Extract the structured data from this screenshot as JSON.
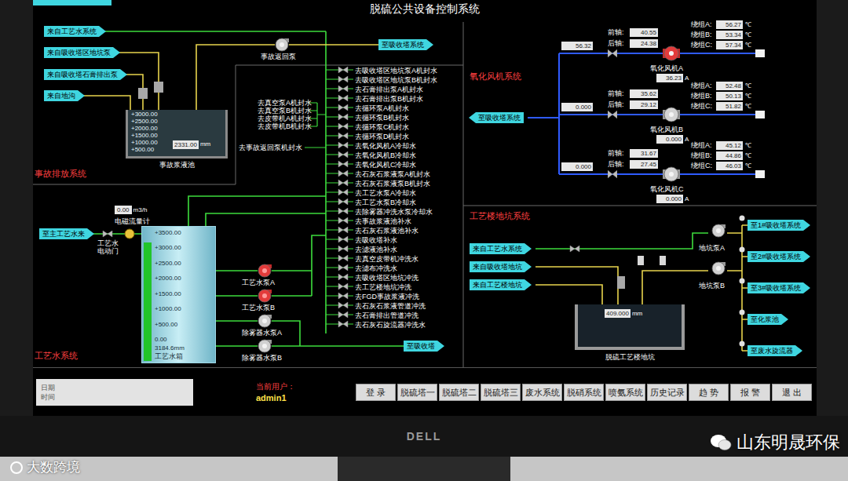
{
  "title": "脱硫公共设备控制系统",
  "accident": {
    "label": "事故排放系统",
    "sources": [
      "来自工艺水系统",
      "来自吸收塔区地坑泵",
      "来自吸收塔石膏排出泵",
      "来自地沟"
    ],
    "pump": {
      "name": "事故返回泵",
      "running": false
    },
    "destination": "至吸收塔系统",
    "tank": {
      "name": "事故浆液池",
      "scale": [
        "+3000.00",
        "+2500.00",
        "+2000.00",
        "+1500.00",
        "+1000.00",
        "+500.00"
      ],
      "reading": "2331.00",
      "unit": "mm"
    }
  },
  "consumers": {
    "main": [
      "去吸收塔区地坑泵A机封水",
      "去吸收塔区地坑泵B机封水",
      "去石膏排出泵A机封水",
      "去石膏排出泵B机封水",
      "去循环泵A机封水",
      "去循环泵B机封水",
      "去循环泵C机封水",
      "去循环泵D机封水",
      "去氧化风机A冷却水",
      "去氧化风机B冷却水",
      "去氧化风机C冷却水",
      "去石灰石浆液泵A机封水",
      "去石灰石浆液泵B机封水",
      "去工艺水泵A冷却水",
      "去工艺水泵B冷却水",
      "去除雾器冲洗水泵冷却水",
      "去事故浆液池补水",
      "去石灰石浆液池补水",
      "去吸收塔补水",
      "去滤液池补水",
      "去真空皮带机冲洗水",
      "去滤布冲洗水",
      "去吸收塔区地坑冲洗",
      "去工艺楼地坑冲洗",
      "去FGD事故浆液冲洗",
      "去石灰石浆液管道冲洗",
      "去石膏排出管道冲洗",
      "去石灰石旋流器冲洗水"
    ],
    "side": [
      "去真空泵A机封水",
      "去真空泵B机封水",
      "去皮带机A机封水",
      "去皮带机B机封水"
    ],
    "extra": "去事故返回泵机封水"
  },
  "process_water": {
    "label": "工艺水系统",
    "source": "至主工艺水来",
    "valve": "工艺水电动门",
    "flowmeter": "电磁流量计",
    "flow_reading": "0.00",
    "flow_unit": "m3/h",
    "tank": {
      "name": "工艺水箱",
      "scale": [
        "+3500.00",
        "+3000.00",
        "+2500.00",
        "+2000.00",
        "+1500.00",
        "+1000.00",
        "+500.00",
        "0.00"
      ],
      "reading": "3184.6mm",
      "level": 0.91
    },
    "pumps": [
      {
        "name": "工艺水泵A",
        "running": true
      },
      {
        "name": "工艺水泵B",
        "running": true
      },
      {
        "name": "除雾器水泵A",
        "running": false
      },
      {
        "name": "除雾器水泵B",
        "running": false
      }
    ],
    "destination": "至吸收塔"
  },
  "oxidation": {
    "label": "氧化风机系统",
    "destination": "至吸收塔系统",
    "temp_unit": "℃",
    "current_unit": "A",
    "fans": [
      {
        "name": "氧化风机A",
        "running": true,
        "pressure": "56.32",
        "front_label": "前轴:",
        "front": "40.55",
        "rear_label": "后轴:",
        "rear": "24.38",
        "windings": [
          {
            "label": "绕组A:",
            "value": "56.27"
          },
          {
            "label": "绕组B:",
            "value": "53.34"
          },
          {
            "label": "绕组C:",
            "value": "57.34"
          }
        ],
        "current": "36.23"
      },
      {
        "name": "氧化风机B",
        "running": false,
        "pressure": "0.000",
        "front_label": "前轴:",
        "front": "35.62",
        "rear_label": "后轴:",
        "rear": "29.12",
        "windings": [
          {
            "label": "绕组A:",
            "value": "52.48"
          },
          {
            "label": "绕组B:",
            "value": "50.13"
          },
          {
            "label": "绕组C:",
            "value": "51.82"
          }
        ],
        "current": "0.000"
      },
      {
        "name": "氧化风机C",
        "running": false,
        "pressure": "0.000",
        "front_label": "前轴:",
        "front": "31.67",
        "rear_label": "后轴:",
        "rear": "27.45",
        "windings": [
          {
            "label": "绕组A:",
            "value": "45.12"
          },
          {
            "label": "绕组B:",
            "value": "44.86"
          },
          {
            "label": "绕组C:",
            "value": "46.03"
          }
        ],
        "current": "0.000"
      }
    ]
  },
  "pit": {
    "label": "工艺楼地坑系统",
    "sources": [
      "来自工艺水系统",
      "来自吸收塔地坑",
      "来自工艺楼地坑"
    ],
    "pumps": [
      {
        "name": "地坑泵A",
        "running": false
      },
      {
        "name": "地坑泵B",
        "running": false
      }
    ],
    "pit_name": "脱硫工艺楼地坑",
    "reading": "409.000",
    "unit": "mm",
    "destinations": [
      "至1#吸收塔系统",
      "至2#吸收塔系统",
      "至3#吸收塔系统",
      "至化浆池",
      "至废水旋流器"
    ]
  },
  "bottom_bar": {
    "info": [
      "日期",
      "时间"
    ],
    "user_label": "当前用户：",
    "user": "admin1",
    "buttons": [
      "登 录",
      "脱硫塔一",
      "脱硫塔二",
      "脱硫塔三",
      "废水系统",
      "脱硝系统",
      "喷氨系统",
      "历史记录",
      "趋 势",
      "报 警",
      "退 出"
    ]
  },
  "bezel": {
    "brand": "DELL"
  },
  "watermarks": [
    "大数跨境",
    "山东明晟环保"
  ]
}
